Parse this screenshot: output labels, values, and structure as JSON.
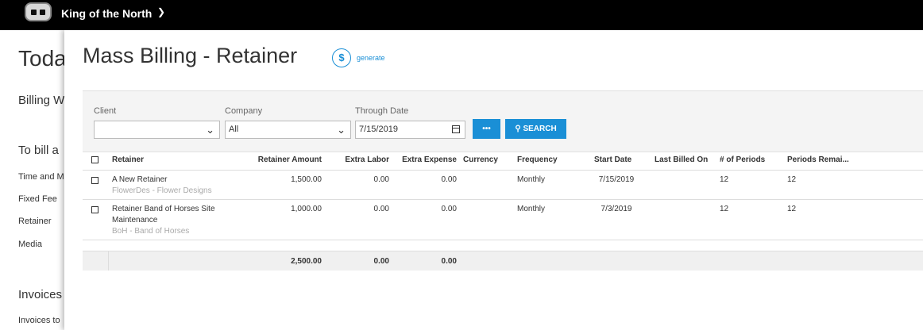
{
  "topbar": {
    "org_name": "King of the North"
  },
  "background_page": {
    "title": "Toda",
    "billing": "Billing W",
    "to_bill": "To bill a",
    "links": [
      "Time and M",
      "Fixed Fee",
      "Retainer",
      "Media"
    ],
    "invoices": "Invoices",
    "invoices_to": "Invoices to"
  },
  "panel": {
    "title": "Mass Billing - Retainer",
    "generate_label": "generate"
  },
  "filters": {
    "client_label": "Client",
    "client_value": "",
    "company_label": "Company",
    "company_value": "All",
    "through_label": "Through Date",
    "through_value": "7/15/2019",
    "more_label": "•••",
    "search_label": "SEARCH"
  },
  "table": {
    "headers": [
      "Retainer",
      "Retainer Amount",
      "Extra Labor",
      "Extra Expense",
      "Currency",
      "Frequency",
      "Start Date",
      "Last Billed On",
      "# of Periods",
      "Periods Remai..."
    ],
    "rows": [
      {
        "name": "A New Retainer",
        "sub": "FlowerDes - Flower Designs",
        "amount": "1,500.00",
        "labor": "0.00",
        "expense": "0.00",
        "currency": "",
        "frequency": "Monthly",
        "start": "7/15/2019",
        "last_billed": "",
        "periods": "12",
        "remaining": "12"
      },
      {
        "name": "Retainer Band of Horses Site",
        "name2": "Maintenance",
        "sub": "BoH - Band of Horses",
        "amount": "1,000.00",
        "labor": "0.00",
        "expense": "0.00",
        "currency": "",
        "frequency": "Monthly",
        "start": "7/3/2019",
        "last_billed": "",
        "periods": "12",
        "remaining": "12"
      }
    ],
    "totals": {
      "amount": "2,500.00",
      "labor": "0.00",
      "expense": "0.00"
    }
  }
}
